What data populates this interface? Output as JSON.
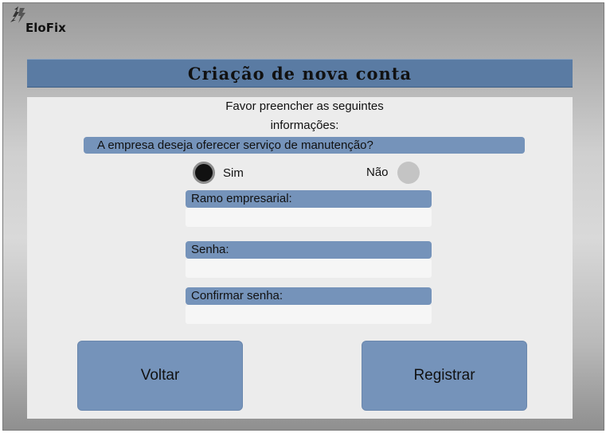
{
  "app": {
    "brand": "EloFix",
    "logo_icon": "lightning-bolt-icon"
  },
  "header": {
    "title": "Criação de nova conta"
  },
  "form": {
    "intro_line1": "Favor preencher as seguintes",
    "intro_line2": "informações:",
    "question": "A empresa deseja oferecer serviço de manutenção?",
    "option_yes": "Sim",
    "option_no": "Não",
    "selected_option": "Sim",
    "fields": [
      {
        "label": "Ramo empresarial:",
        "value": ""
      },
      {
        "label": "Senha:",
        "value": ""
      },
      {
        "label": "Confirmar senha:",
        "value": ""
      }
    ]
  },
  "actions": {
    "back_label": "Voltar",
    "register_label": "Registrar"
  },
  "colors": {
    "accent": "#7593ba",
    "title_bar": "#5a7ba3",
    "panel": "#ececec"
  }
}
